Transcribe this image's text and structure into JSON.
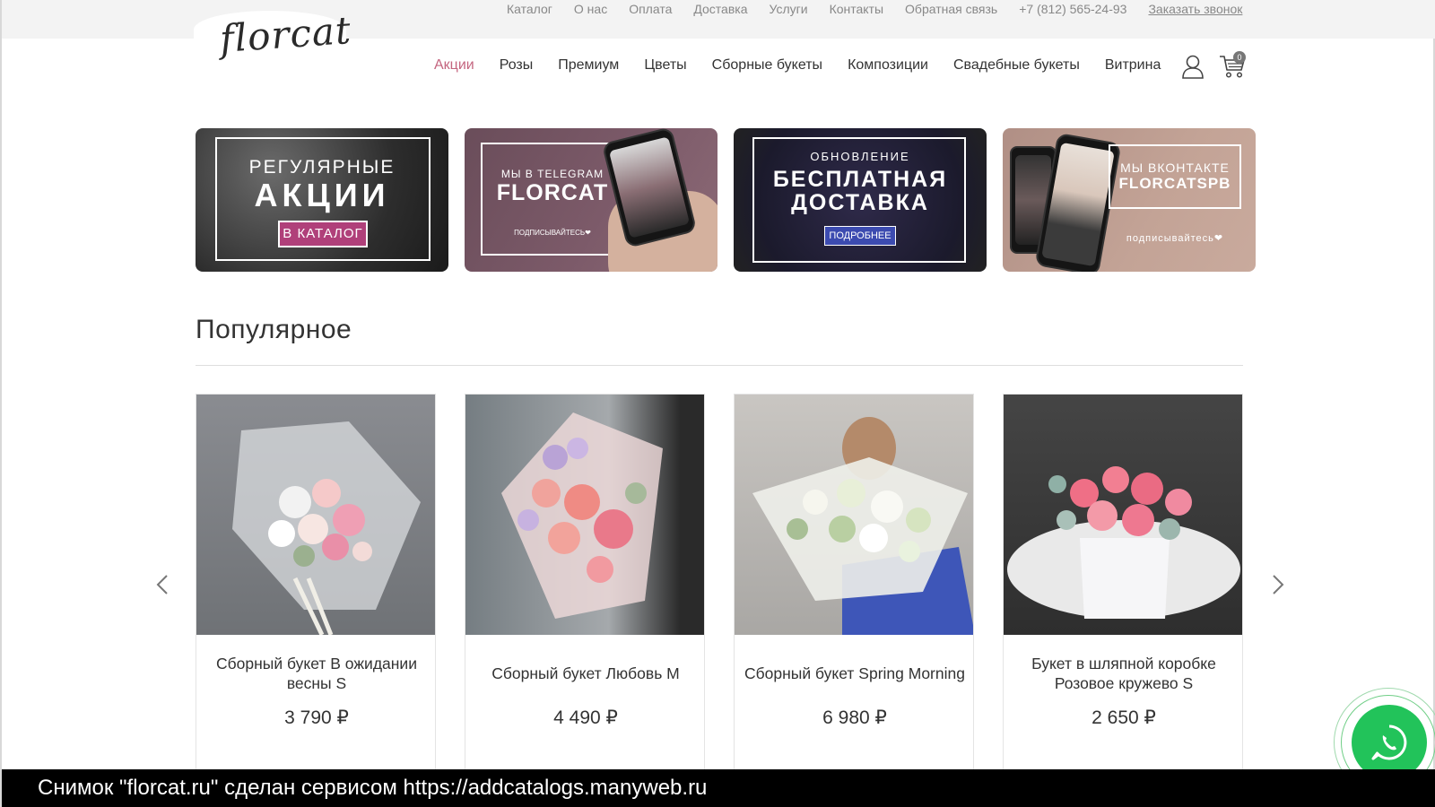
{
  "site": {
    "logo_text": "florcat"
  },
  "topnav": {
    "items": [
      "Каталог",
      "О нас",
      "Оплата",
      "Доставка",
      "Услуги",
      "Контакты",
      "Обратная связь",
      "+7 (812) 565-24-93"
    ],
    "callback": "Заказать звонок"
  },
  "mainnav": {
    "items": [
      "Акции",
      "Розы",
      "Премиум",
      "Цветы",
      "Сборные букеты",
      "Композиции",
      "Свадебные букеты",
      "Витрина"
    ],
    "active": "Акции",
    "cart_count": "0"
  },
  "banners": {
    "b1": {
      "line1": "РЕГУЛЯРНЫЕ",
      "line2": "АКЦИИ",
      "button": "В КАТАЛОГ"
    },
    "b2": {
      "line1": "МЫ В TELEGRAM",
      "line2": "FLORCAT",
      "line3": "ПОДПИСЫВАЙТЕСЬ❤"
    },
    "b3": {
      "line1": "ОБНОВЛЕНИЕ",
      "line2": "БЕСПЛАТНАЯ",
      "line3": "ДОСТАВКА",
      "button": "ПОДРОБНЕЕ"
    },
    "b4": {
      "line1": "МЫ ВКОНТАКТЕ",
      "line2": "FLORCATSPB",
      "line3": "подписывайтесь❤"
    }
  },
  "popular": {
    "title": "Популярное",
    "products": [
      {
        "name": "Сборный букет В ожидании весны S",
        "price": "3 790 ₽"
      },
      {
        "name": "Сборный букет Любовь M",
        "price": "4 490 ₽"
      },
      {
        "name": "Сборный букет Spring Morning",
        "price": "6 980 ₽"
      },
      {
        "name": "Букет в шляпной коробке Розовое кружево S",
        "price": "2 650 ₽"
      }
    ]
  },
  "caption": "Снимок \"florcat.ru\" сделан сервисом https://addcatalogs.manyweb.ru",
  "colors": {
    "accent": "#c4657f",
    "whatsapp": "#22c35a",
    "banner_button": "#b0407a",
    "banner_button2": "#3c4bb0"
  },
  "icons": [
    "user-icon",
    "cart-icon",
    "chevron-left-icon",
    "chevron-right-icon",
    "whatsapp-icon"
  ]
}
